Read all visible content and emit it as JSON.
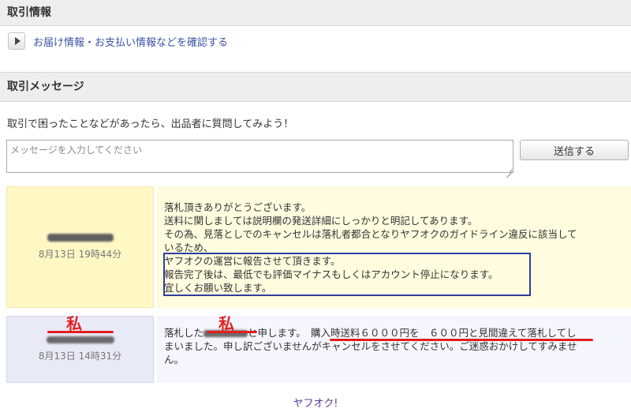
{
  "sections": {
    "trade_info": {
      "title": "取引情報",
      "link_label": "お届け情報・お支払い情報などを確認する"
    },
    "trade_message": {
      "title": "取引メッセージ",
      "prompt": "取引で困ったことなどがあったら、出品者に質問してみよう！",
      "input_placeholder": "メッセージを入力してください",
      "send_label": "送信する"
    }
  },
  "messages": [
    {
      "timestamp": "8月13日 19時44分",
      "lines": [
        "落札頂きありがとうございます。",
        "送料に関しましては説明欄の発送詳細にしっかりと明記してあります。",
        "その為、見落としでのキャンセルは落札者都合となりヤフオクのガイドライン違反に該当して",
        "いるため、",
        "ヤフオクの運営に報告させて頂きます。",
        "報告完了後は、最低でも評価マイナスもしくはアカウント停止になります。",
        "宜しくお願い致します。"
      ]
    },
    {
      "timestamp": "8月13日 14時31分",
      "me_label": "私",
      "line1_pre": "落札した",
      "line1_mid": "と申します。",
      "line1_highlight": "購入時送料６０００円を　６００円と見間違えて落札",
      "line1_post": "してし",
      "line2": "まいました。申し訳ございませんがキャンセルをさせてください。ご迷惑おかけしてすみませ",
      "line3": "ん。"
    }
  ],
  "footer": {
    "link": "ヤフオク!"
  },
  "colors": {
    "link": "#3c52a5",
    "annotation_red": "#e02020",
    "annotation_box": "#2e3ea0"
  }
}
